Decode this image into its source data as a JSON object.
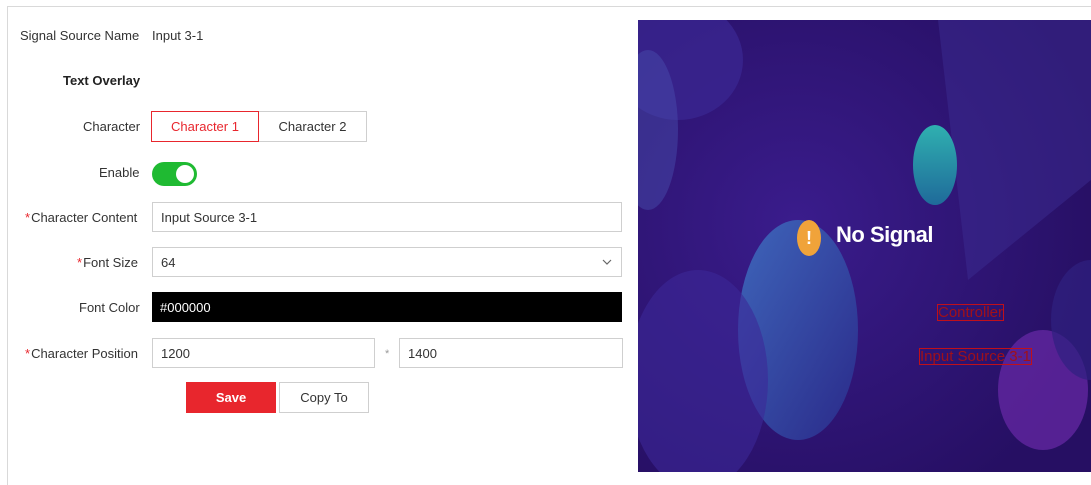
{
  "form": {
    "signal_source_label": "Signal Source Name",
    "signal_source_value": "Input 3-1",
    "section_title": "Text Overlay",
    "character_label": "Character",
    "character_tabs": [
      "Character 1",
      "Character 2"
    ],
    "enable_label": "Enable",
    "enable_state": true,
    "content_label": "Character Content",
    "content_value": "Input Source 3-1",
    "font_size_label": "Font Size",
    "font_size_value": "64",
    "font_color_label": "Font Color",
    "font_color_value": "#000000",
    "position_label": "Character Position",
    "position_x": "1200",
    "position_separator": "*",
    "position_y": "1400",
    "required_mark": "*"
  },
  "actions": {
    "save_label": "Save",
    "copy_label": "Copy To"
  },
  "preview": {
    "status_text": "No Signal",
    "warning_glyph": "!",
    "overlay_1": "Controller",
    "overlay_2": "Input Source 3-1"
  },
  "colors": {
    "accent": "#e8262d",
    "toggle_on": "#1fba32",
    "preview_bg": "#2c1470"
  },
  "icons": [
    "chevron-down-icon",
    "warning-icon"
  ]
}
